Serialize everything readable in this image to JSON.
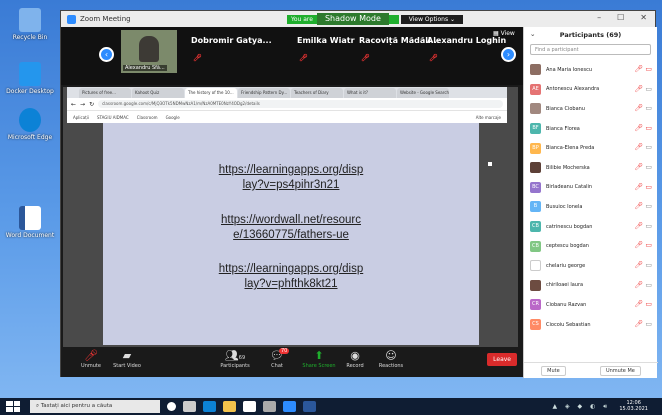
{
  "desktop": {
    "icons": [
      {
        "label": "Recycle Bin",
        "color": "#4a8ee0"
      },
      {
        "label": "Docker Desktop",
        "color": "#2496ed"
      },
      {
        "label": "Microsoft Edge",
        "color": "#0c82d6"
      },
      {
        "label": "Word Document",
        "color": "#2b579a"
      }
    ]
  },
  "zoom": {
    "title": "Zoom Meeting",
    "talking_you": "You are",
    "shadow_mode": "Shadow Mode",
    "view_options": "View Options ⌄",
    "view_label": "View",
    "gallery": {
      "main_name": "Alexandru Sfă...",
      "participants": [
        "Dobromir Gatya...",
        "Emilka Wiatr",
        "Racoviță Mădăli...",
        "Alexandru Loghin"
      ]
    },
    "browser": {
      "tabs": [
        "Pictures of free...",
        "Kahoot Quiz",
        "The history of the 10...",
        "Friendship Pattern Dy...",
        "Teachers of Diary",
        "What is it?",
        "Website - Google Search"
      ],
      "url": "classroom.google.com/c/MjQ3OTk5NDMwNzA1/m/NzA0MTE0NzY4ODg2/details",
      "bookmarks": [
        "Aplicații",
        "STAGIU AIDMAC",
        "Classroom",
        "Google",
        "Alte marcaje"
      ]
    },
    "slide_links": [
      [
        "https://learningapps.org/disp",
        "lay?v=ps4pihr3n21"
      ],
      [
        "https://wordwall.net/resourc",
        "e/13660775/fathers-ue"
      ],
      [
        "https://learningapps.org/disp",
        "lay?v=phfthk8kt21"
      ]
    ],
    "toolbar": {
      "unmute": "Unmute",
      "start_video": "Start Video",
      "participants": "Participants",
      "participants_count": "69",
      "chat": "Chat",
      "chat_badge": "70",
      "share_screen": "Share Screen",
      "record": "Record",
      "reactions": "Reactions",
      "leave": "Leave"
    }
  },
  "participants_panel": {
    "title": "Participants (69)",
    "search_placeholder": "Find a participant",
    "list": [
      {
        "initials": "",
        "name": "Ana Maria Ionescu",
        "color": "#8d6e63"
      },
      {
        "initials": "AE",
        "name": "Antonescu Alexandra",
        "color": "#e57373"
      },
      {
        "initials": "",
        "name": "Bianca Ciobanu",
        "color": "#a1887f"
      },
      {
        "initials": "BF",
        "name": "Bianca Florea",
        "color": "#4db6ac"
      },
      {
        "initials": "BP",
        "name": "Bianca-Elena Preda",
        "color": "#ffb74d"
      },
      {
        "initials": "",
        "name": "Bilibie Mocherska",
        "color": "#5d4037"
      },
      {
        "initials": "BC",
        "name": "Birladeanu Catalin",
        "color": "#9575cd"
      },
      {
        "initials": "B",
        "name": "Busuioc Ionela",
        "color": "#64b5f6"
      },
      {
        "initials": "CB",
        "name": "catrinescu bogdan",
        "color": "#4db6ac"
      },
      {
        "initials": "CB",
        "name": "ceptescu bogdan",
        "color": "#81c784"
      },
      {
        "initials": "",
        "name": "chelariu george",
        "color": "#ffffff"
      },
      {
        "initials": "",
        "name": "chiriloaei laura",
        "color": "#6d4c41"
      },
      {
        "initials": "CR",
        "name": "Ciobanu Razvan",
        "color": "#ba68c8"
      },
      {
        "initials": "CS",
        "name": "Ciocoiu Sebastian",
        "color": "#ff8a65"
      }
    ],
    "mute_all": "Mute",
    "unmute_me": "Unmute Me"
  },
  "taskbar": {
    "search_placeholder": "Tastați aici pentru a căuta",
    "time": "12:06",
    "date": "15.03.2021"
  }
}
